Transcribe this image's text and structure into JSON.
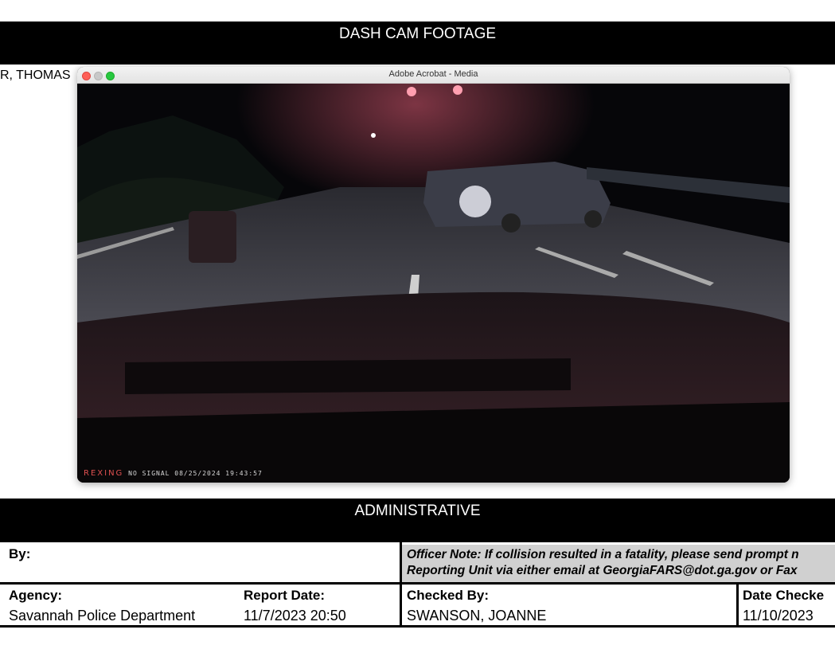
{
  "sections": {
    "dash_cam_title": "DASH CAM FOOTAGE",
    "admin_title": "ADMINISTRATIVE"
  },
  "name_fragment": "R, THOMAS",
  "media_window": {
    "title": "Adobe Acrobat - Media",
    "osd_brand": "REXING",
    "osd_text": "NO SIGNAL 08/25/2024 19:43:57"
  },
  "admin": {
    "by_label": "By:",
    "note_line1": "Officer Note: If collision resulted in a fatality, please send prompt n",
    "note_line2": "Reporting Unit via either email at GeorgiaFARS@dot.ga.gov or Fax",
    "agency_label": "Agency:",
    "agency_value": "Savannah Police Department",
    "report_date_label": "Report Date:",
    "report_date_value": "11/7/2023 20:50",
    "checked_by_label": "Checked By:",
    "checked_by_value": "SWANSON, JOANNE",
    "date_checked_label": "Date Checke",
    "date_checked_value": "11/10/2023"
  },
  "colors": {
    "banner": "#000000",
    "note_bg": "#d0d0d0",
    "traffic_close": "#fe5f57",
    "traffic_max": "#28c840"
  }
}
